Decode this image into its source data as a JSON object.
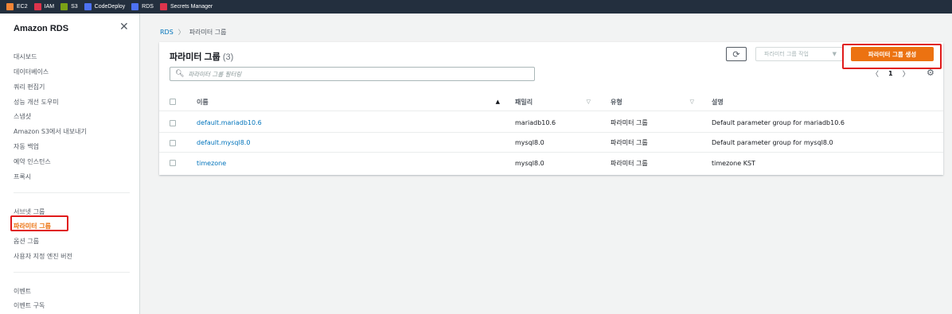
{
  "topbar": {
    "services": [
      {
        "label": "EC2",
        "icon": "ec2-icon",
        "color": "#f58536"
      },
      {
        "label": "IAM",
        "icon": "iam-icon",
        "color": "#dd344c"
      },
      {
        "label": "S3",
        "icon": "s3-icon",
        "color": "#7aa116"
      },
      {
        "label": "CodeDeploy",
        "icon": "codedeploy-icon",
        "color": "#4d72f3"
      },
      {
        "label": "RDS",
        "icon": "rds-icon",
        "color": "#4d72f3"
      },
      {
        "label": "Secrets Manager",
        "icon": "secrets-manager-icon",
        "color": "#dd344c"
      }
    ]
  },
  "sidebar": {
    "title": "Amazon RDS",
    "close_icon": "close-icon",
    "groups": [
      [
        "대시보드",
        "데이터베이스",
        "쿼리 편집기",
        "성능 개선 도우미",
        "스냅샷",
        "Amazon S3에서 내보내기",
        "자동 백업",
        "예약 인스턴스",
        "프록시"
      ],
      [
        "서브넷 그룹",
        "파라미터 그룹",
        "옵션 그룹",
        "사용자 지정 엔진 버전"
      ],
      [
        "이벤트",
        "이벤트 구독"
      ]
    ],
    "active_item": "파라미터 그룹"
  },
  "breadcrumb": {
    "root": "RDS",
    "current": "파라미터 그룹"
  },
  "panel": {
    "title": "파라미터 그룹",
    "count": "(3)",
    "refresh_icon": "refresh-icon",
    "actions_label": "파라미터 그룹 작업",
    "create_label": "파라미터 그룹 생성",
    "filter_placeholder": "파라미터 그룹 필터링",
    "page": "1",
    "settings_icon": "gear-icon"
  },
  "table": {
    "columns": [
      "이름",
      "패밀리",
      "유형",
      "설명"
    ],
    "sort_column": "이름",
    "rows": [
      {
        "name": "default.mariadb10.6",
        "family": "mariadb10.6",
        "type": "파라미터 그룹",
        "description": "Default parameter group for mariadb10.6"
      },
      {
        "name": "default.mysql8.0",
        "family": "mysql8.0",
        "type": "파라미터 그룹",
        "description": "Default parameter group for mysql8.0"
      },
      {
        "name": "timezone",
        "family": "mysql8.0",
        "type": "파라미터 그룹",
        "description": "timezone KST"
      }
    ]
  },
  "colors": {
    "topbar_bg": "#232f3e",
    "accent": "#ec7211",
    "link": "#0073bb",
    "highlight": "#e01b1b"
  }
}
